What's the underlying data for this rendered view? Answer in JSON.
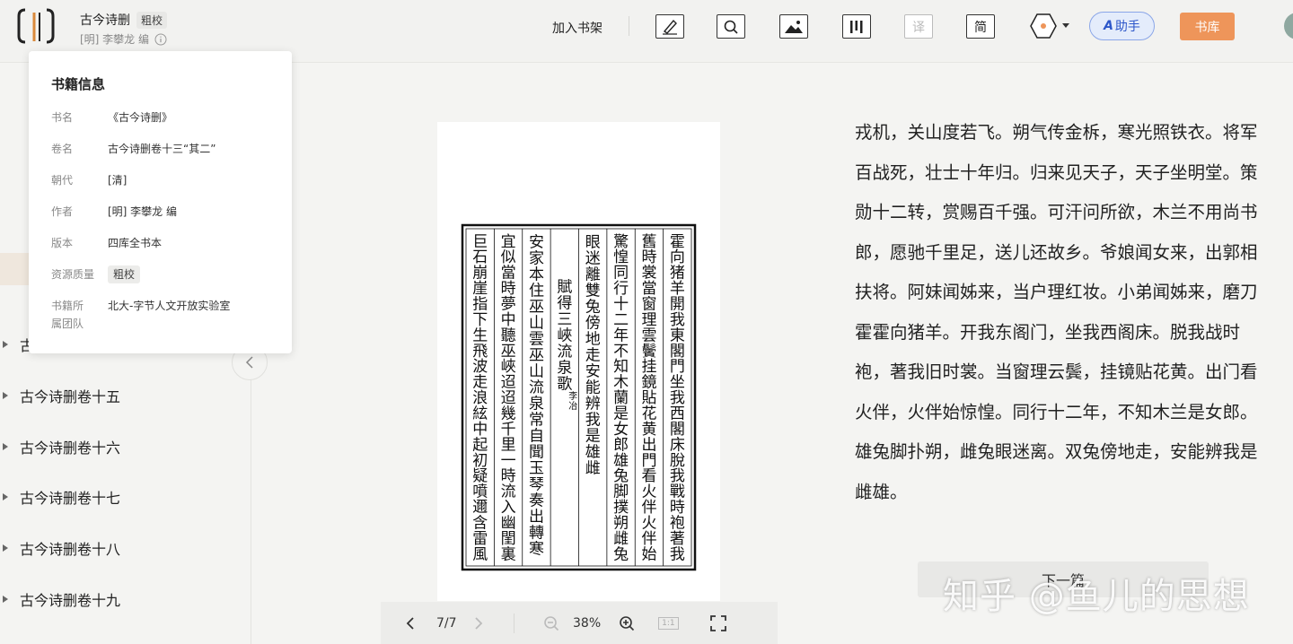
{
  "header": {
    "book_title": "古今诗删",
    "title_badge": "粗校",
    "author_line": "[明] 李攀龙 编",
    "add_to_shelf": "加入书架",
    "tools": {
      "translate": "译",
      "simplified": "简"
    },
    "assistant_label": "助手",
    "assistant_icon_text": "A",
    "library_button": "书库"
  },
  "info_panel": {
    "title": "书籍信息",
    "rows": [
      {
        "label": "书名",
        "value": "《古今诗删》"
      },
      {
        "label": "卷名",
        "value": "古今诗删卷十三“其二”"
      },
      {
        "label": "朝代",
        "value": "[清]"
      },
      {
        "label": "作者",
        "value": "[明] 李攀龙 编"
      },
      {
        "label": "版本",
        "value": "四库全书本"
      },
      {
        "label": "资源质量",
        "value": "粗校"
      },
      {
        "label": "书籍所属团队",
        "value": "北大-字节人文开放实验室"
      }
    ]
  },
  "toc": {
    "partial_item": "古",
    "items": [
      {
        "label": "古今诗删卷十五"
      },
      {
        "label": "古今诗删卷十六"
      },
      {
        "label": "古今诗删卷十七"
      },
      {
        "label": "古今诗删卷十八"
      },
      {
        "label": "古今诗删卷十九"
      }
    ]
  },
  "viewer": {
    "page_indicator": "7/7",
    "zoom": "38%",
    "actual_size_label": "1:1"
  },
  "transcription": {
    "lines": [
      "戎机，关山度若飞。朔气传金柝，寒光照铁衣。将军",
      "百战死，壮士十年归。归来见天子，天子坐明堂。策",
      "勋十二转，赏赐百千强。可汗问所欲，木兰不用尚书",
      "郎，愿驰千里足，送儿还故乡。爷娘闻女来，出郭相",
      "扶将。阿妹闻姊来，当户理红妆。小弟闻姊来，磨刀",
      "霍霍向猪羊。开我东阁门，坐我西阁床。脱我战时",
      "袍，著我旧时裳。当窗理云鬓，挂镜贴花黄。出门看",
      "火伴，火伴始惊惶。同行十二年，不知木兰是女郎。",
      "雄兔脚扑朔，雌兔眼迷离。双兔傍地走，安能辨我是",
      "雌雄。"
    ]
  },
  "next_chapter": "下一篇",
  "watermark": "知乎 @鱼儿的思想",
  "scan": {
    "columns": [
      "霍向猪羊開我東閣門坐我西閣床脫我戰時袍著我",
      "舊時裳當窗理雲鬢挂鏡貼花黄出門看火伴火伴始",
      "驚惶同行十二年不知木蘭是女郎雄兔脚撲朔雌兔",
      "眼迷離雙兔傍地走安能辨我是雄雌",
      "賦得三峽流泉歌",
      "安家本住巫山雲巫山流泉常自聞玉琴奏出轉寒",
      "宜似當時夢中聽巫峽迢迢幾千里一時流入幽閨裏",
      "巨石崩崖指下生飛波走浪絃中起初疑噴邇含雷風"
    ],
    "small_author": "李冶"
  }
}
